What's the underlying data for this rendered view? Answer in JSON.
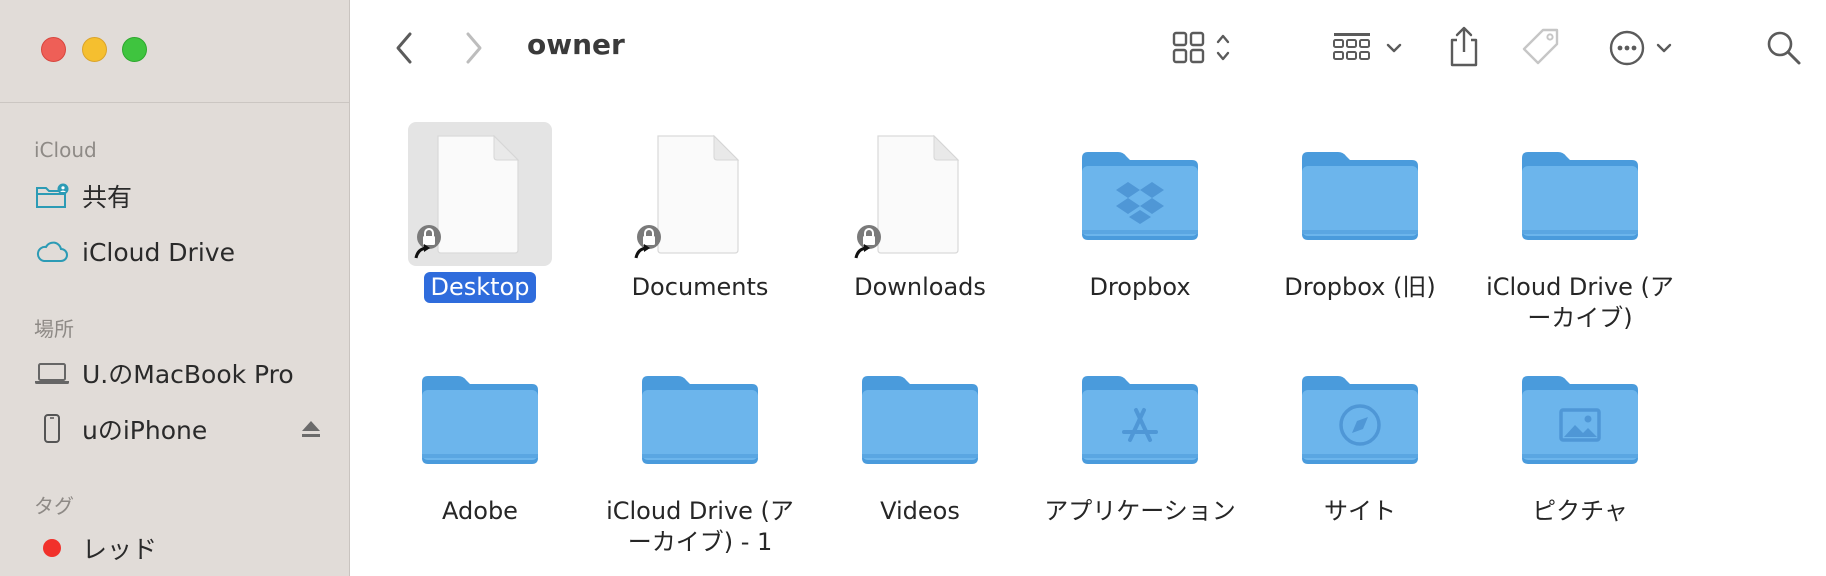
{
  "window": {
    "title": "owner"
  },
  "sidebar": {
    "icloud_heading": "iCloud",
    "icloud_items": [
      {
        "label": "共有",
        "icon": "shared-folder-icon"
      },
      {
        "label": "iCloud Drive",
        "icon": "cloud-icon"
      }
    ],
    "locations_heading": "場所",
    "location_items": [
      {
        "label": "U.のMacBook Pro",
        "icon": "laptop-icon"
      },
      {
        "label": "uのiPhone",
        "icon": "iphone-icon"
      }
    ],
    "tags_heading": "タグ",
    "tag_items": [
      {
        "label": "レッド",
        "color": "#f1312b"
      }
    ]
  },
  "toolbar": {
    "icons": [
      "back-icon",
      "forward-icon",
      "icon-view-icon",
      "group-icon",
      "share-icon",
      "tag-icon",
      "more-icon",
      "search-icon"
    ]
  },
  "files": [
    {
      "name": "Desktop",
      "type": "alias-document",
      "selected": true
    },
    {
      "name": "Documents",
      "type": "alias-document",
      "selected": false
    },
    {
      "name": "Downloads",
      "type": "alias-document",
      "selected": false
    },
    {
      "name": "Dropbox",
      "type": "folder-dropbox",
      "selected": false
    },
    {
      "name": "Dropbox (旧)",
      "type": "folder",
      "selected": false
    },
    {
      "name": "iCloud Drive (アーカイブ)",
      "type": "folder",
      "selected": false
    },
    {
      "name": "Adobe",
      "type": "folder",
      "selected": false
    },
    {
      "name": "iCloud Drive (アーカイブ) - 1",
      "type": "folder",
      "selected": false
    },
    {
      "name": "Videos",
      "type": "folder",
      "selected": false
    },
    {
      "name": "アプリケーション",
      "type": "folder-apps",
      "selected": false
    },
    {
      "name": "サイト",
      "type": "folder-safari",
      "selected": false
    },
    {
      "name": "ピクチャ",
      "type": "folder-pictures",
      "selected": false
    }
  ],
  "colors": {
    "folder": "#6cb5ec",
    "selection": "#2f6cdc",
    "sidebar": "#e1dcd8"
  }
}
